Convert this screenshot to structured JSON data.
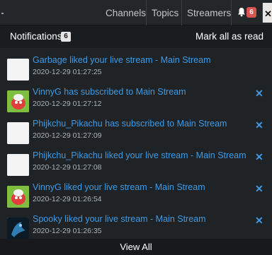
{
  "topbar": {
    "nav": [
      "Channels",
      "Topics",
      "Streamers"
    ],
    "bell_count": "6"
  },
  "panel": {
    "title": "Notifications",
    "count": "6",
    "mark_all": "Mark all as read",
    "view_all": "View All"
  },
  "notifications": [
    {
      "text": "Garbage liked your live stream - Main Stream",
      "time": "2020-12-29 01:27:25",
      "avatar": "blank"
    },
    {
      "text": "VinnyG has subscribed to Main Stream",
      "time": "2020-12-29 01:27:12",
      "avatar": "character"
    },
    {
      "text": "Phijkchu_Pikachu has subscribed to Main Stream",
      "time": "2020-12-29 01:27:09",
      "avatar": "blank"
    },
    {
      "text": "Phijkchu_Pikachu liked your live stream - Main Stream",
      "time": "2020-12-29 01:27:08",
      "avatar": "blank"
    },
    {
      "text": "VinnyG liked your live stream - Main Stream",
      "time": "2020-12-29 01:26:54",
      "avatar": "character"
    },
    {
      "text": "Spooky liked your live stream - Main Stream",
      "time": "2020-12-29 01:26:35",
      "avatar": "dark"
    }
  ]
}
